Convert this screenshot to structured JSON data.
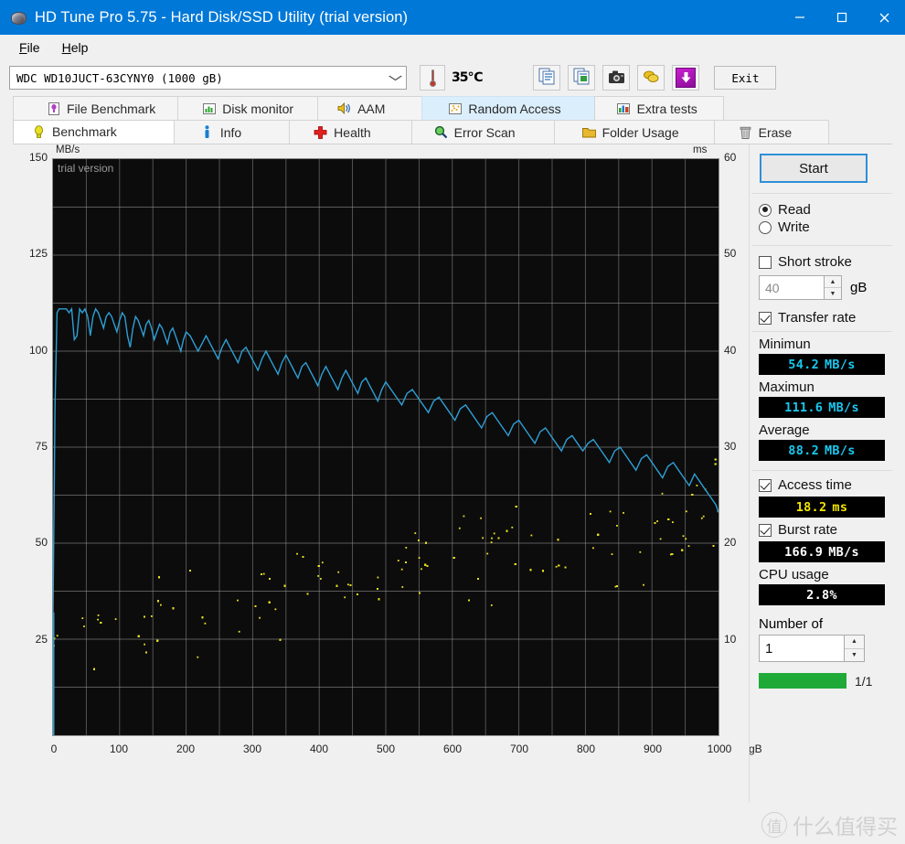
{
  "window": {
    "title": "HD Tune Pro 5.75 - Hard Disk/SSD Utility (trial version)",
    "icon": "hdd-icon",
    "minimize": "–",
    "maximize": "□",
    "close": "✕"
  },
  "menu": {
    "items": [
      {
        "label": "File",
        "mnemonic": "F"
      },
      {
        "label": "Help",
        "mnemonic": "H"
      }
    ]
  },
  "toolbar": {
    "drive": "WDC WD10JUCT-63CYNY0 (1000 gB)",
    "drive_chevron": "⌄",
    "temperature": "35℃",
    "temp_icon": "thermometer-icon",
    "buttons": [
      {
        "name": "copy-icon",
        "label": ""
      },
      {
        "name": "copy-image-icon",
        "label": ""
      },
      {
        "name": "camera-icon",
        "label": ""
      },
      {
        "name": "coins-icon",
        "label": ""
      },
      {
        "name": "download-icon",
        "label": ""
      }
    ],
    "exit_label": "Exit"
  },
  "tabs": {
    "row1": [
      {
        "label": "File Benchmark",
        "icon": "file-benchmark-icon",
        "state": "normal"
      },
      {
        "label": "Disk monitor",
        "icon": "disk-monitor-icon",
        "state": "normal"
      },
      {
        "label": "AAM",
        "icon": "speaker-icon",
        "state": "normal"
      },
      {
        "label": "Random Access",
        "icon": "random-access-icon",
        "state": "hover"
      },
      {
        "label": "Extra tests",
        "icon": "extra-tests-icon",
        "state": "normal"
      }
    ],
    "row2": [
      {
        "label": "Benchmark",
        "icon": "bulb-icon",
        "state": "active"
      },
      {
        "label": "Info",
        "icon": "info-icon",
        "state": "normal"
      },
      {
        "label": "Health",
        "icon": "health-cross-icon",
        "state": "normal"
      },
      {
        "label": "Error Scan",
        "icon": "magnifier-icon",
        "state": "normal"
      },
      {
        "label": "Folder Usage",
        "icon": "folder-icon",
        "state": "normal"
      },
      {
        "label": "Erase",
        "icon": "trash-icon",
        "state": "normal"
      }
    ]
  },
  "panel": {
    "start_label": "Start",
    "mode": {
      "read": "Read",
      "write": "Write",
      "selected": "Read"
    },
    "short_stroke": {
      "label": "Short stroke",
      "checked": false,
      "value": "40",
      "unit": "gB"
    },
    "transfer_rate": {
      "label": "Transfer rate",
      "checked": true
    },
    "minimum": {
      "label": "Minimun",
      "value": "54.2",
      "unit": "MB/s"
    },
    "maximum": {
      "label": "Maximun",
      "value": "111.6",
      "unit": "MB/s"
    },
    "average": {
      "label": "Average",
      "value": "88.2",
      "unit": "MB/s"
    },
    "access_time": {
      "label": "Access time",
      "checked": true,
      "value": "18.2",
      "unit": "ms"
    },
    "burst_rate": {
      "label": "Burst rate",
      "checked": true,
      "value": "166.9",
      "unit": "MB/s"
    },
    "cpu_usage": {
      "label": "CPU usage",
      "value": "2.8%",
      "unit": ""
    },
    "number_of": {
      "label": "Number of",
      "value": "1"
    },
    "progress": {
      "count": "1/1",
      "percent": 100,
      "color": "#1faa38"
    }
  },
  "watermark": {
    "trial": "trial version",
    "brand": "什么值得买",
    "brand_mark": "值"
  },
  "chart_data": {
    "type": "line",
    "title": "",
    "xlabel": "gB",
    "ylabel": "MB/s",
    "y2label": "ms",
    "xlim": [
      0,
      1000
    ],
    "ylim": [
      0,
      150
    ],
    "y2lim": [
      0,
      60
    ],
    "grid": true,
    "x_ticks": [
      0,
      100,
      200,
      300,
      400,
      500,
      600,
      700,
      800,
      900,
      1000
    ],
    "y_ticks": [
      25,
      50,
      75,
      100,
      125,
      150
    ],
    "y2_ticks": [
      10,
      20,
      30,
      40,
      50,
      60
    ],
    "bg_color": "#0c0c0c",
    "grid_color": "#9a9a9a",
    "series": [
      {
        "name": "Transfer rate",
        "type": "line",
        "color": "#2e9fd4",
        "axis": "left",
        "units": "MB/s",
        "x": [
          0,
          3,
          6,
          9,
          12,
          16,
          20,
          24,
          28,
          32,
          36,
          40,
          44,
          48,
          52,
          56,
          60,
          64,
          68,
          72,
          76,
          80,
          84,
          88,
          92,
          96,
          100,
          104,
          108,
          112,
          116,
          120,
          124,
          128,
          132,
          136,
          140,
          144,
          148,
          152,
          156,
          160,
          164,
          168,
          172,
          176,
          180,
          184,
          188,
          192,
          196,
          200,
          206,
          212,
          218,
          224,
          230,
          236,
          242,
          248,
          254,
          260,
          266,
          272,
          278,
          284,
          290,
          296,
          302,
          308,
          314,
          320,
          326,
          332,
          338,
          344,
          350,
          356,
          362,
          368,
          374,
          380,
          386,
          392,
          398,
          404,
          410,
          416,
          422,
          428,
          434,
          440,
          446,
          452,
          458,
          464,
          470,
          476,
          482,
          488,
          494,
          500,
          508,
          516,
          524,
          532,
          540,
          548,
          556,
          564,
          572,
          580,
          588,
          596,
          604,
          612,
          620,
          628,
          636,
          644,
          652,
          660,
          668,
          676,
          684,
          692,
          700,
          708,
          716,
          724,
          732,
          740,
          748,
          756,
          764,
          772,
          780,
          788,
          796,
          804,
          812,
          820,
          828,
          836,
          844,
          852,
          860,
          868,
          876,
          884,
          892,
          900,
          908,
          916,
          924,
          932,
          940,
          948,
          956,
          964,
          972,
          980,
          988,
          996,
          1000
        ],
        "y": [
          32,
          86,
          110,
          111,
          111,
          111,
          111,
          110,
          111,
          103,
          104,
          111,
          110,
          111,
          109,
          104,
          109,
          111,
          110,
          108,
          106,
          109,
          110,
          109,
          107,
          105,
          108,
          110,
          109,
          104,
          101,
          106,
          109,
          108,
          106,
          104,
          107,
          108,
          106,
          103,
          105,
          107,
          106,
          104,
          102,
          105,
          106,
          104,
          102,
          100,
          103,
          105,
          104,
          102,
          100,
          102,
          104,
          102,
          100,
          98,
          101,
          103,
          101,
          99,
          97,
          100,
          101,
          99,
          97,
          95,
          98,
          100,
          98,
          96,
          94,
          97,
          99,
          97,
          95,
          93,
          96,
          97,
          95,
          93,
          91,
          94,
          96,
          94,
          92,
          90,
          93,
          95,
          93,
          91,
          89,
          92,
          93,
          91,
          89,
          87,
          90,
          92,
          90,
          88,
          86,
          89,
          90,
          88,
          86,
          84,
          87,
          88,
          86,
          84,
          82,
          85,
          86,
          84,
          82,
          80,
          83,
          84,
          82,
          80,
          78,
          81,
          82,
          80,
          78,
          76,
          79,
          80,
          78,
          76,
          74,
          77,
          78,
          76,
          74,
          76,
          77,
          75,
          73,
          71,
          74,
          75,
          73,
          71,
          69,
          72,
          73,
          71,
          69,
          67,
          70,
          71,
          69,
          67,
          65,
          68,
          66,
          64,
          62,
          60,
          58,
          57,
          56,
          55,
          55
        ]
      },
      {
        "name": "Access time",
        "type": "scatter",
        "color": "#e8e020",
        "axis": "right",
        "units": "ms",
        "mean": 18.2,
        "note": "approximately 700 scattered samples rising from ~8 ms near the outer tracks (low gB) to ~28 ms at the inner tracks (high gB)",
        "count": 700
      }
    ]
  }
}
